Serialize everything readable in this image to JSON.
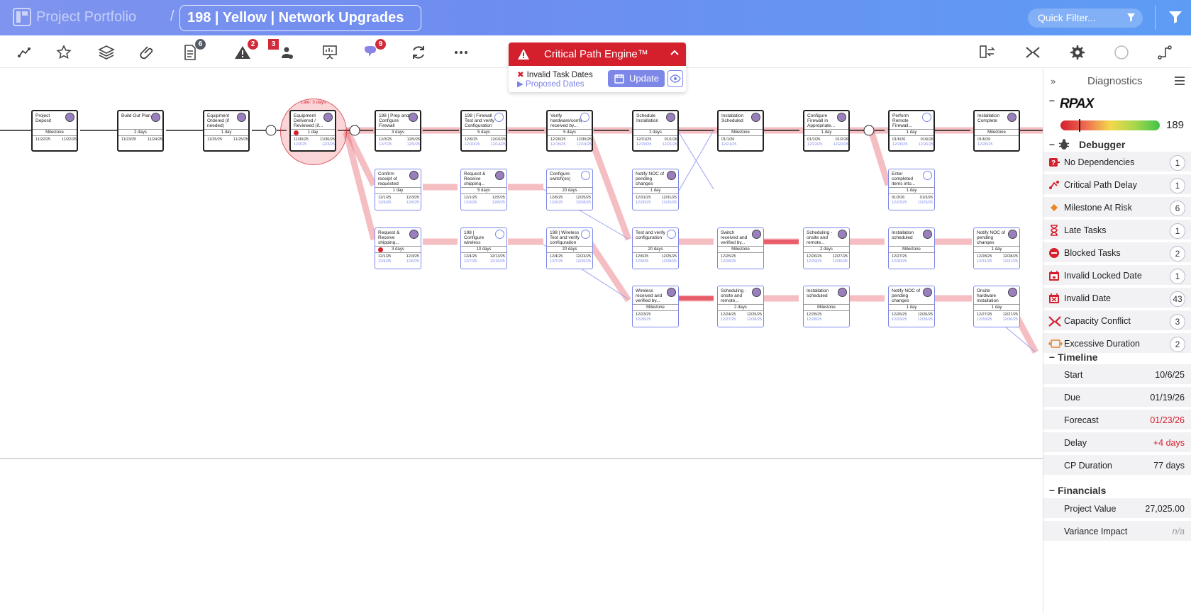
{
  "header": {
    "portfolio": "Project Portfolio",
    "separator": "/",
    "project": "198 | Yellow | Network Upgrades",
    "quick_filter": "Quick Filter..."
  },
  "toolbar": {
    "badges": {
      "documents": "6",
      "warnings": "2",
      "resources": "3",
      "messages": "9"
    }
  },
  "critical_path": {
    "title": "Critical Path Engine™",
    "invalid": "Invalid Task Dates",
    "proposed": "Proposed Dates",
    "update": "Update"
  },
  "canvas": {
    "late_label": "Late: 3 days",
    "tasks": [
      {
        "name": "Project Deposit",
        "dur": "Milestone",
        "d1": "11/22/25",
        "d2": "11/22/25",
        "late": ""
      },
      {
        "name": "Build Out Plan",
        "dur": "2 days",
        "d1": "11/23/25",
        "d2": "11/24/25"
      },
      {
        "name": "Equipment Ordered (if needed)",
        "dur": "1 day",
        "d1": "11/25/25",
        "d2": "11/25/25"
      },
      {
        "name": "Equipment Delivered / Reviewed (if...",
        "dur": "1 day",
        "d1": "11/30/25",
        "d2": "11/30/25",
        "d3": "12/3/25",
        "d4": "12/3/25"
      },
      {
        "name": "198 | Prep and Configure Firewall",
        "dur": "3 days",
        "d1": "12/3/25",
        "d2": "12/5/25",
        "d3": "12/7/25",
        "d4": "12/9/25"
      },
      {
        "name": "198 | Firewall Test and verify Configuration",
        "dur": "5 days",
        "d1": "12/6/25",
        "d2": "12/10/25",
        "d3": "12/10/25",
        "d4": "12/14/25"
      },
      {
        "name": "Verify hardware/config received by...",
        "dur": "5 days",
        "d1": "12/26/25",
        "d2": "12/30/25",
        "d3": "12/15/25",
        "d4": "12/19/25"
      },
      {
        "name": "Schedule Installation",
        "dur": "2 days",
        "d1": "12/31/25",
        "d2": "01/1/26",
        "d3": "12/20/25",
        "d4": "12/21/25"
      },
      {
        "name": "Installation Scheduled",
        "dur": "Milestone",
        "d1": "01/1/26",
        "d2": "",
        "d3": "12/21/25",
        "d4": ""
      },
      {
        "name": "Configure Firewall in Appropriate...",
        "dur": "1 day",
        "d1": "01/2/26",
        "d2": "01/2/26",
        "d3": "12/22/25",
        "d4": "12/22/25"
      },
      {
        "name": "Perform Remote Firewall...",
        "dur": "1 day",
        "d1": "01/6/26",
        "d2": "01/6/26",
        "d3": "12/26/25",
        "d4": "12/26/25"
      },
      {
        "name": "Installation Complete",
        "dur": "Milestone",
        "d1": "01/6/26",
        "d2": "",
        "d3": "12/26/25",
        "d4": ""
      },
      {
        "name": "Confirm receipt of requested credentials/infor...",
        "dur": "1 day",
        "d1": "12/1/25",
        "d2": "12/3/25",
        "d3": "12/6/25",
        "d4": "12/6/25"
      },
      {
        "name": "Request & Receive shipping...",
        "dur": "5 days",
        "d1": "12/1/25",
        "d2": "12/5/25",
        "d3": "12/3/25",
        "d4": "12/8/25"
      },
      {
        "name": "Configure switch(es)",
        "dur": "20 days",
        "d1": "12/6/25",
        "d2": "12/25/25",
        "d3": "12/9/25",
        "d4": "12/28/25"
      },
      {
        "name": "Notify NOC of pending changes",
        "dur": "1 day",
        "d1": "12/31/25",
        "d2": "12/31/25",
        "d3": "12/20/25",
        "d4": "12/20/25"
      },
      {
        "name": "Enter completed items into...",
        "dur": "1 day",
        "d1": "01/3/26",
        "d2": "01/3/26",
        "d3": "12/23/25",
        "d4": "12/23/25"
      },
      {
        "name": "Request & Receive shipping...",
        "dur": "3 days",
        "d1": "12/1/25",
        "d2": "12/3/25",
        "d3": "12/4/25",
        "d4": "12/6/25"
      },
      {
        "name": "198 | Configure wireless",
        "dur": "10 days",
        "d1": "12/4/25",
        "d2": "12/13/25",
        "d3": "12/7/25",
        "d4": "12/16/25"
      },
      {
        "name": "198 | Wireless Test and verify configuration",
        "dur": "20 days",
        "d1": "12/4/25",
        "d2": "12/23/25",
        "d3": "12/7/25",
        "d4": "12/26/25"
      },
      {
        "name": "Test and verify configuration",
        "dur": "20 days",
        "d1": "12/6/25",
        "d2": "12/25/25",
        "d3": "12/9/25",
        "d4": "12/28/25"
      },
      {
        "name": "Switch received and verified by...",
        "dur": "Milestone",
        "d1": "12/25/25",
        "d2": "",
        "d3": "12/28/25",
        "d4": ""
      },
      {
        "name": "Scheduling - onsite and remote...",
        "dur": "2 days",
        "d1": "12/26/25",
        "d2": "12/27/25",
        "d3": "12/29/25",
        "d4": "12/30/25"
      },
      {
        "name": "Installation scheduled",
        "dur": "Milestone",
        "d1": "12/27/25",
        "d2": "",
        "d3": "12/30/25",
        "d4": ""
      },
      {
        "name": "Notify NOC of pending changes",
        "dur": "1 day",
        "d1": "12/28/25",
        "d2": "12/28/25",
        "d3": "12/31/25",
        "d4": "12/31/25"
      },
      {
        "name": "Wireless received and verified by...",
        "dur": "Milestone",
        "d1": "12/23/25",
        "d2": "",
        "d3": "12/26/25",
        "d4": ""
      },
      {
        "name": "Scheduling - onsite and remote...",
        "dur": "2 days",
        "d1": "12/24/25",
        "d2": "12/25/25",
        "d3": "12/27/25",
        "d4": "12/28/25"
      },
      {
        "name": "Installation scheduled",
        "dur": "Milestone",
        "d1": "12/25/25",
        "d2": "",
        "d3": "12/28/25",
        "d4": ""
      },
      {
        "name": "Notify NOC of pending changes",
        "dur": "1 day",
        "d1": "12/26/25",
        "d2": "12/26/25",
        "d3": "12/29/25",
        "d4": "12/29/25"
      },
      {
        "name": "Onsite hardware installation",
        "dur": "1 day",
        "d1": "12/27/25",
        "d2": "12/27/25",
        "d3": "12/30/25",
        "d4": "12/30/25"
      }
    ]
  },
  "panel": {
    "title": "Diagnostics",
    "brand": "RPAX",
    "score": "189",
    "debugger_title": "Debugger",
    "debugger": [
      {
        "label": "No Dependencies",
        "count": "1"
      },
      {
        "label": "Critical Path Delay",
        "count": "1"
      },
      {
        "label": "Milestone At Risk",
        "count": "6"
      },
      {
        "label": "Late Tasks",
        "count": "1"
      },
      {
        "label": "Blocked Tasks",
        "count": "2"
      },
      {
        "label": "Invalid Locked Date",
        "count": "1"
      },
      {
        "label": "Invalid Date",
        "count": "43"
      },
      {
        "label": "Capacity Conflict",
        "count": "3"
      },
      {
        "label": "Excessive Duration",
        "count": "2"
      }
    ],
    "timeline_title": "Timeline",
    "timeline": [
      {
        "label": "Start",
        "value": "10/6/25"
      },
      {
        "label": "Due",
        "value": "01/19/26"
      },
      {
        "label": "Forecast",
        "value": "01/23/26"
      },
      {
        "label": "Delay",
        "value": "+4 days"
      },
      {
        "label": "CP Duration",
        "value": "77 days"
      }
    ],
    "financials_title": "Financials",
    "financials": [
      {
        "label": "Project Value",
        "value": "27,025.00"
      },
      {
        "label": "Variance Impact",
        "value": "n/a"
      }
    ]
  }
}
